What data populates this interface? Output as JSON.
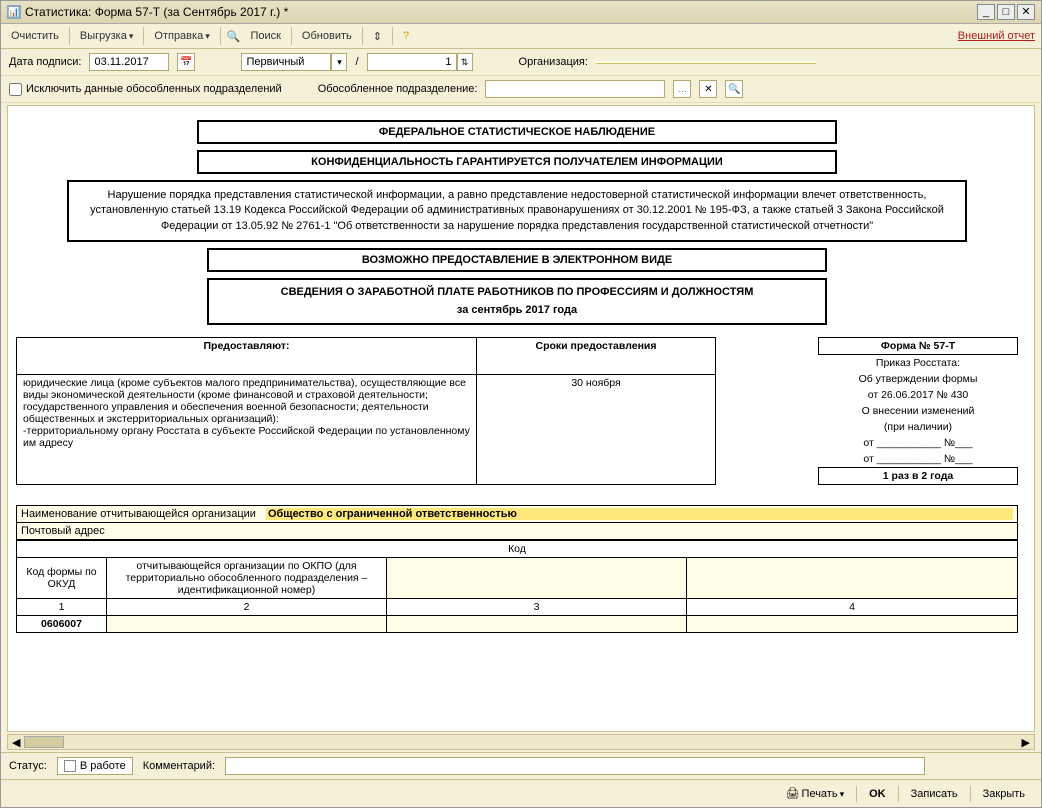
{
  "titlebar": {
    "title": "Статистика: Форма 57-Т (за Сентябрь 2017 г.) *"
  },
  "toolbar": {
    "clear": "Очистить",
    "upload": "Выгрузка",
    "send": "Отправка",
    "search": "Поиск",
    "refresh": "Обновить",
    "external": "Внешний отчет"
  },
  "params": {
    "sign_date_label": "Дата подписи:",
    "sign_date": "03.11.2017",
    "type_value": "Первичный",
    "slash": "/",
    "num": "1",
    "org_label": "Организация:",
    "org_value": "",
    "exclude_label": "Исключить данные обособленных подразделений",
    "obos_label": "Обособленное подразделение:",
    "obos_value": ""
  },
  "doc": {
    "h1": "ФЕДЕРАЛЬНОЕ СТАТИСТИЧЕСКОЕ НАБЛЮДЕНИЕ",
    "h2": "КОНФИДЕНЦИАЛЬНОСТЬ ГАРАНТИРУЕТСЯ ПОЛУЧАТЕЛЕМ ИНФОРМАЦИИ",
    "warn": "Нарушение порядка представления статистической информации, а равно представление недостоверной статистической информации влечет ответственность, установленную статьей 13.19 Кодекса Российской Федерации об административных правонарушениях от 30.12.2001 № 195-ФЗ, а также статьей 3 Закона Российской Федерации от 13.05.92 № 2761-1 \"Об ответственности за нарушение порядка представления государственной статистической отчетности\"",
    "elec": "ВОЗМОЖНО ПРЕДОСТАВЛЕНИЕ В ЭЛЕКТРОННОМ ВИДЕ",
    "title": "СВЕДЕНИЯ О ЗАРАБОТНОЙ ПЛАТЕ РАБОТНИКОВ ПО ПРОФЕССИЯМ И ДОЛЖНОСТЯМ",
    "period": "за сентябрь 2017 года",
    "provide_hdr": "Предоставляют:",
    "terms_hdr": "Сроки предоставления",
    "provide_body": "юридические лица (кроме субъектов малого предпринимательства), осуществляющие все виды экономической деятельности (кроме финансовой и страховой деятельности; государственного управления и обеспечения военной безопасности; деятельности общественных и экстерриториальных организаций):\n   -территориальному органу Росстата в субъекте Российской Федерации по установленному им адресу",
    "terms_body": "30 ноября",
    "formno": "Форма № 57-Т",
    "order1": "Приказ Росстата:",
    "order2": "Об утверждении формы",
    "order3": "от 26.06.2017 № 430",
    "order4": "О внесении изменений",
    "order5": "(при наличии)",
    "ot": "от ___________ №___",
    "freq": "1 раз в 2 года",
    "orgname_lbl": "Наименование отчитывающейся организации",
    "orgname_val": "Общество с ограниченной ответственностью",
    "addr_lbl": "Почтовый адрес",
    "code_hdr": "Код",
    "col1": "Код формы по ОКУД",
    "col2": "отчитывающейся организации по ОКПО (для территориально обособленного подразделения – идентификационной номер)",
    "n1": "1",
    "n2": "2",
    "n3": "3",
    "n4": "4",
    "okud": "0606007"
  },
  "status": {
    "label": "Статус:",
    "value": "В работе",
    "comment_lbl": "Комментарий:"
  },
  "bottom": {
    "print": "Печать",
    "ok": "OK",
    "save": "Записать",
    "close": "Закрыть"
  }
}
